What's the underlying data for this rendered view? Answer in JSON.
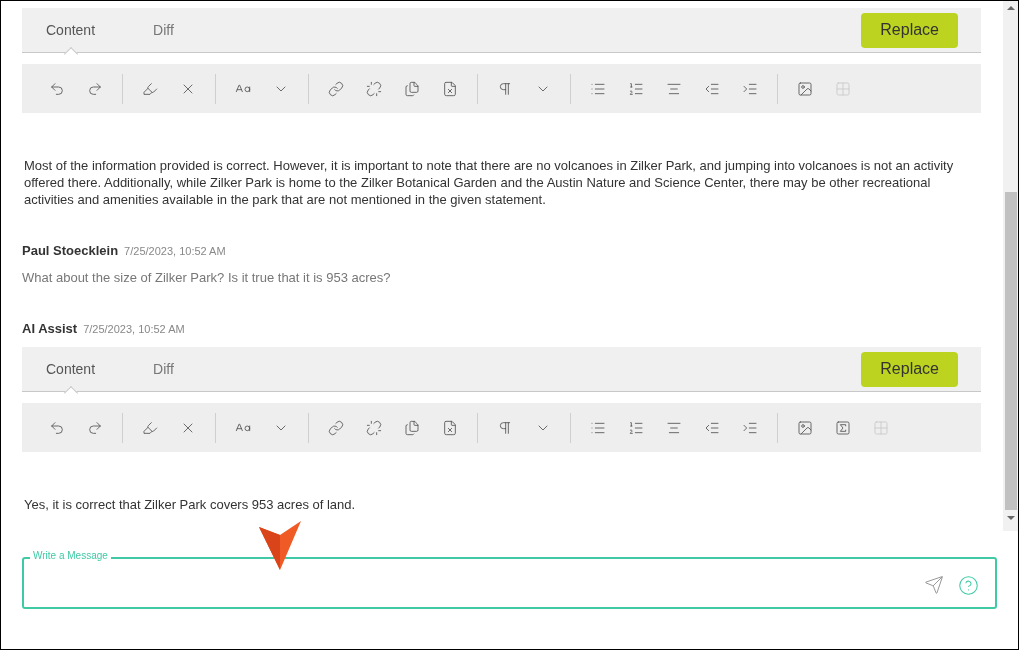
{
  "messages": [
    {
      "kind": "ai",
      "editor": {
        "tabs": [
          {
            "label": "Content",
            "selected": true
          },
          {
            "label": "Diff",
            "selected": false
          }
        ],
        "button": "Replace",
        "formula_tool": false
      },
      "text": "Most of the information provided is correct. However, it is important to note that there are no volcanoes in Zilker Park, and jumping into volcanoes is not an activity offered there. Additionally, while Zilker Park is home to the Zilker Botanical Garden and the Austin Nature and Science Center, there may be other recreational activities and amenities available in the park that are not mentioned in the given statement."
    },
    {
      "kind": "user",
      "author": "Paul Stoecklein",
      "time": "7/25/2023, 10:52 AM",
      "text": "What about the size of Zilker Park? Is it true that it is 953 acres?"
    },
    {
      "kind": "ai",
      "author": "AI Assist",
      "time": "7/25/2023, 10:52 AM",
      "editor": {
        "tabs": [
          {
            "label": "Content",
            "selected": true
          },
          {
            "label": "Diff",
            "selected": false
          }
        ],
        "button": "Replace",
        "formula_tool": true
      },
      "text": "Yes, it is correct that Zilker Park covers 953 acres of land."
    }
  ],
  "composer": {
    "label": "Write a Message"
  }
}
